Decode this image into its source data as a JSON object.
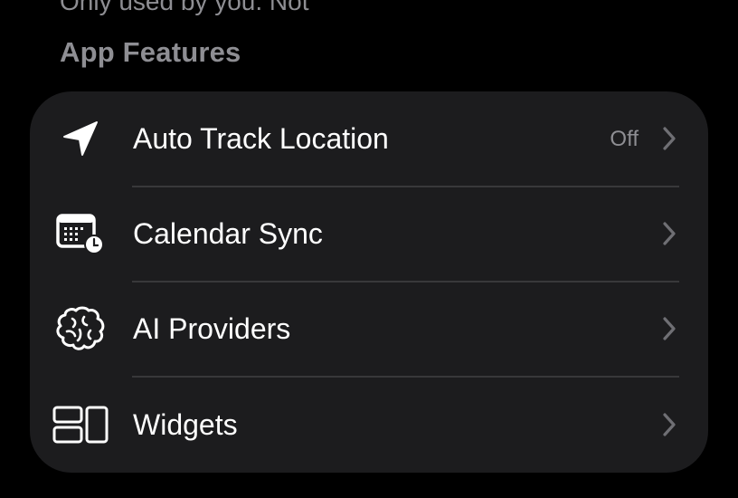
{
  "previous_section": {
    "footer_text": "Only used by you. Not"
  },
  "section": {
    "header": "App Features"
  },
  "rows": [
    {
      "label": "Auto Track Location",
      "value": "Off",
      "icon": "location-arrow-icon"
    },
    {
      "label": "Calendar Sync",
      "value": "",
      "icon": "calendar-clock-icon"
    },
    {
      "label": "AI Providers",
      "value": "",
      "icon": "brain-icon"
    },
    {
      "label": "Widgets",
      "value": "",
      "icon": "widgets-icon"
    }
  ],
  "colors": {
    "background": "#000000",
    "group_background": "#1c1c1e",
    "primary_text": "#ffffff",
    "secondary_text": "#8e8e93",
    "separator": "#38383a",
    "chevron": "#6f6f74"
  }
}
